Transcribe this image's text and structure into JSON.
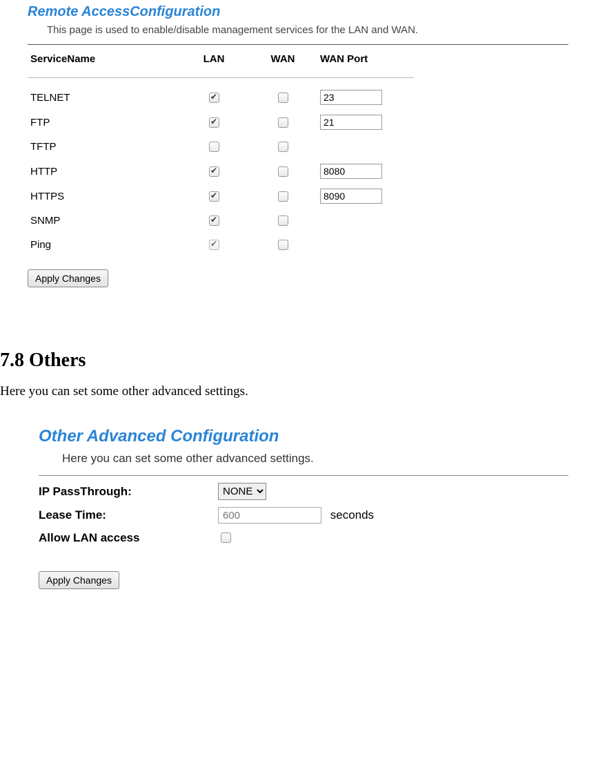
{
  "remote": {
    "title": "Remote AccessConfiguration",
    "desc": "This page is used to enable/disable management services for the LAN and WAN.",
    "headers": {
      "service": "ServiceName",
      "lan": "LAN",
      "wan": "WAN",
      "port": "WAN Port"
    },
    "rows": [
      {
        "name": "TELNET",
        "lan": true,
        "wan": false,
        "port": "23",
        "has_port": true,
        "lan_disabled": false
      },
      {
        "name": "FTP",
        "lan": true,
        "wan": false,
        "port": "21",
        "has_port": true,
        "lan_disabled": false
      },
      {
        "name": "TFTP",
        "lan": false,
        "wan": false,
        "port": "",
        "has_port": false,
        "lan_disabled": false
      },
      {
        "name": "HTTP",
        "lan": true,
        "wan": false,
        "port": "8080",
        "has_port": true,
        "lan_disabled": false
      },
      {
        "name": "HTTPS",
        "lan": true,
        "wan": false,
        "port": "8090",
        "has_port": true,
        "lan_disabled": false
      },
      {
        "name": "SNMP",
        "lan": true,
        "wan": false,
        "port": "",
        "has_port": false,
        "lan_disabled": false
      },
      {
        "name": "Ping",
        "lan": true,
        "wan": false,
        "port": "",
        "has_port": false,
        "lan_disabled": true
      }
    ],
    "apply": "Apply Changes"
  },
  "doc": {
    "heading": "7.8 Others",
    "text": "Here you can set some other advanced settings."
  },
  "other": {
    "title": "Other Advanced Configuration",
    "desc": "Here you can set some other advanced settings.",
    "ip_label": "IP PassThrough:",
    "ip_option": "NONE",
    "lease_label": "Lease Time:",
    "lease_value": "600",
    "lease_unit": "seconds",
    "allow_label": "Allow LAN access",
    "allow_checked": false,
    "apply": "Apply Changes"
  }
}
